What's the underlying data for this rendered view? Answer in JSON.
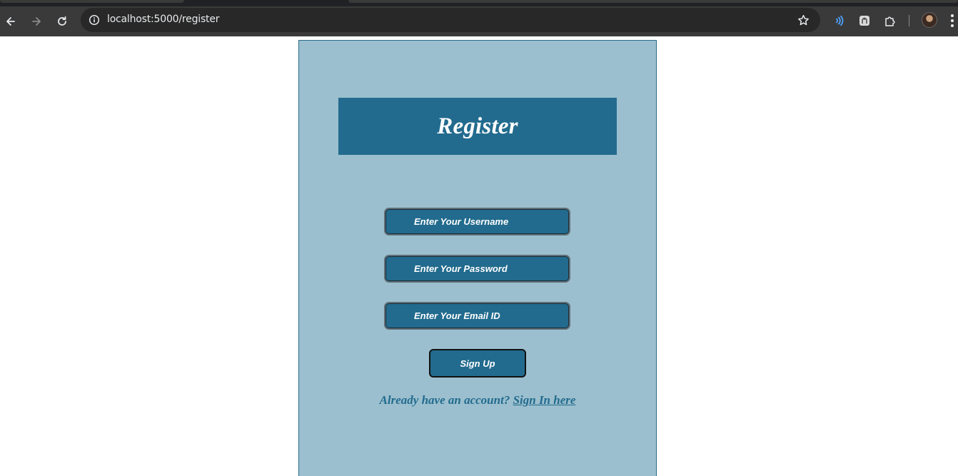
{
  "browser": {
    "url": "localhost:5000/register",
    "icons": {
      "back": "arrow-left-icon",
      "forward": "arrow-right-icon",
      "reload": "reload-icon",
      "site_info": "info-icon",
      "bookmark": "star-icon",
      "extensions": "puzzle-icon",
      "menu": "more-vertical-icon"
    }
  },
  "form": {
    "title": "Register",
    "username_placeholder": "Enter Your Username",
    "password_placeholder": "Enter Your Password",
    "email_placeholder": "Enter Your Email ID",
    "submit_label": "Sign Up",
    "already_text": "Already have an account?",
    "signin_link": "Sign In here"
  },
  "colors": {
    "card_bg": "#9bbfce",
    "accent": "#226b8e",
    "text_on_accent": "#ffffff"
  }
}
